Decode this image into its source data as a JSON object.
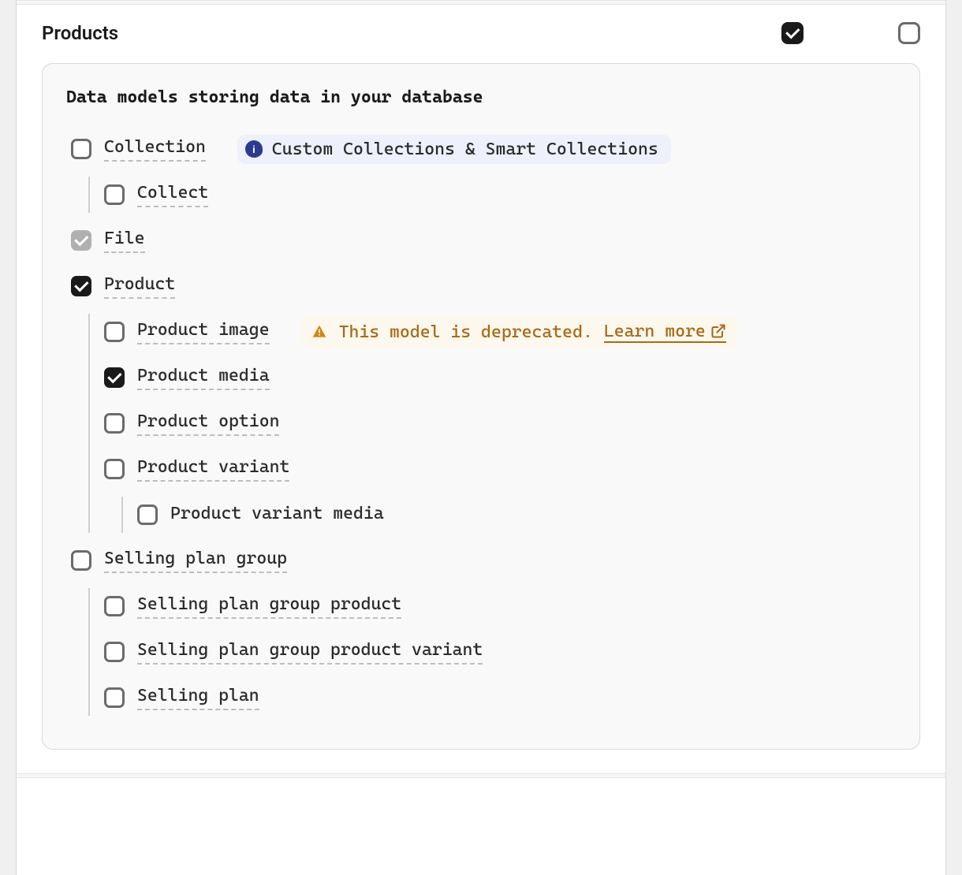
{
  "section": {
    "title": "Products",
    "header_check_left": true,
    "header_check_right": false
  },
  "panel": {
    "heading": "Data models storing data in your database"
  },
  "info": {
    "text": "Custom Collections & Smart Collections"
  },
  "warn": {
    "text": "This model is deprecated.",
    "learn_more": "Learn more"
  },
  "models": {
    "collection": "Collection",
    "collect": "Collect",
    "file": "File",
    "product": "Product",
    "product_image": "Product image",
    "product_media": "Product media",
    "product_option": "Product option",
    "product_variant": "Product variant",
    "product_variant_media": "Product variant media",
    "selling_plan_group": "Selling plan group",
    "selling_plan_group_product": "Selling plan group product",
    "selling_plan_group_product_variant": "Selling plan group product variant",
    "selling_plan": "Selling plan"
  }
}
